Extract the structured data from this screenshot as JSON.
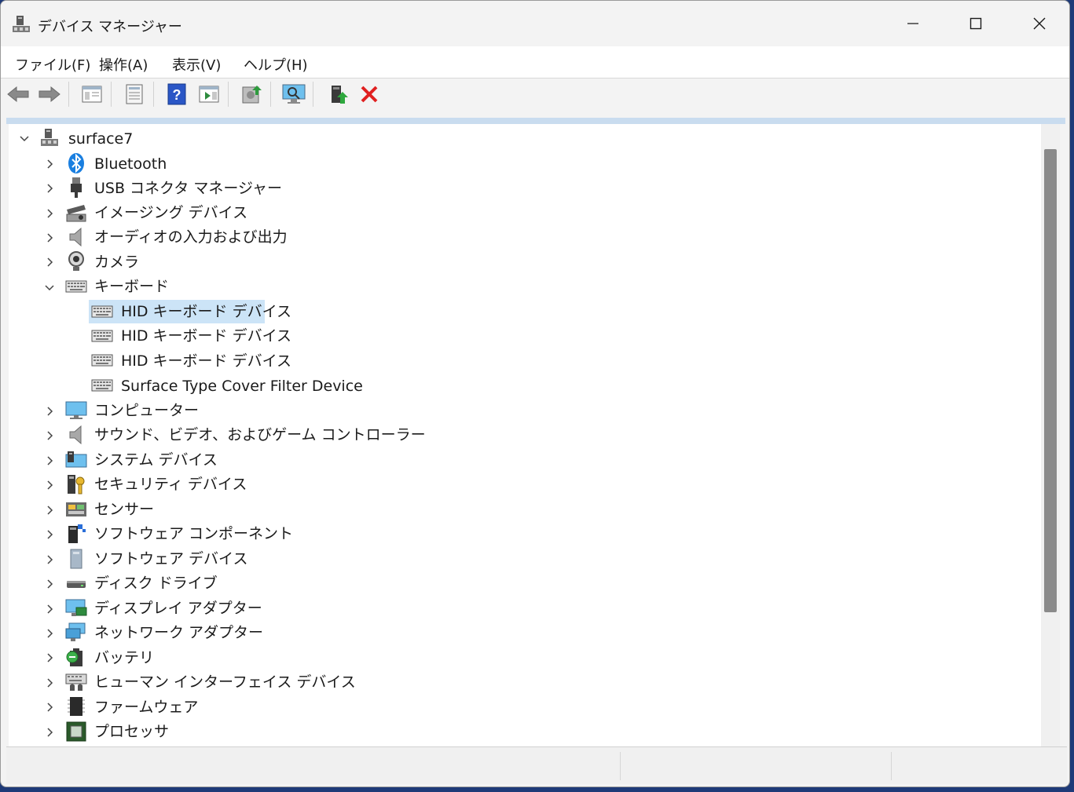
{
  "window": {
    "title": "デバイス マネージャー"
  },
  "menu": [
    {
      "label": "ファイル(F)"
    },
    {
      "label": "操作(A)"
    },
    {
      "label": "表示(V)"
    },
    {
      "label": "ヘルプ(H)"
    }
  ],
  "toolbar": {
    "buttons": [
      {
        "icon": "back-arrow-icon"
      },
      {
        "icon": "forward-arrow-icon"
      },
      {
        "icon": "show-hide-console-tree-icon"
      },
      {
        "icon": "properties-icon"
      },
      {
        "icon": "help-icon"
      },
      {
        "icon": "action-pane-icon"
      },
      {
        "icon": "update-driver-icon"
      },
      {
        "icon": "scan-hardware-icon"
      },
      {
        "icon": "enable-device-icon"
      },
      {
        "icon": "uninstall-device-icon"
      }
    ]
  },
  "tree": {
    "root": "surface7",
    "items": [
      {
        "label": "Bluetooth",
        "icon": "bluetooth-icon"
      },
      {
        "label": "USB コネクタ マネージャー",
        "icon": "usb-connector-icon"
      },
      {
        "label": "イメージング デバイス",
        "icon": "imaging-device-icon"
      },
      {
        "label": "オーディオの入力および出力",
        "icon": "speaker-icon"
      },
      {
        "label": "カメラ",
        "icon": "webcam-icon"
      },
      {
        "label": "キーボード",
        "icon": "keyboard-icon",
        "expanded": true
      },
      {
        "label": "HID キーボード デバイス",
        "icon": "keyboard-icon",
        "child": true,
        "selected": true
      },
      {
        "label": "HID キーボード デバイス",
        "icon": "keyboard-icon",
        "child": true
      },
      {
        "label": "HID キーボード デバイス",
        "icon": "keyboard-icon",
        "child": true
      },
      {
        "label": "Surface Type Cover Filter Device",
        "icon": "keyboard-icon",
        "child": true
      },
      {
        "label": "コンピューター",
        "icon": "monitor-icon"
      },
      {
        "label": "サウンド、ビデオ、およびゲーム コントローラー",
        "icon": "speaker-icon"
      },
      {
        "label": "システム デバイス",
        "icon": "system-device-icon"
      },
      {
        "label": "セキュリティ デバイス",
        "icon": "security-key-icon"
      },
      {
        "label": "センサー",
        "icon": "sensor-icon"
      },
      {
        "label": "ソフトウェア コンポーネント",
        "icon": "software-component-icon"
      },
      {
        "label": "ソフトウェア デバイス",
        "icon": "software-device-icon"
      },
      {
        "label": "ディスク ドライブ",
        "icon": "disk-drive-icon"
      },
      {
        "label": "ディスプレイ アダプター",
        "icon": "display-adapter-icon"
      },
      {
        "label": "ネットワーク アダプター",
        "icon": "network-adapter-icon"
      },
      {
        "label": "バッテリ",
        "icon": "battery-icon"
      },
      {
        "label": "ヒューマン インターフェイス デバイス",
        "icon": "hid-icon"
      },
      {
        "label": "ファームウェア",
        "icon": "firmware-icon"
      },
      {
        "label": "プロセッサ",
        "icon": "processor-icon"
      }
    ]
  }
}
